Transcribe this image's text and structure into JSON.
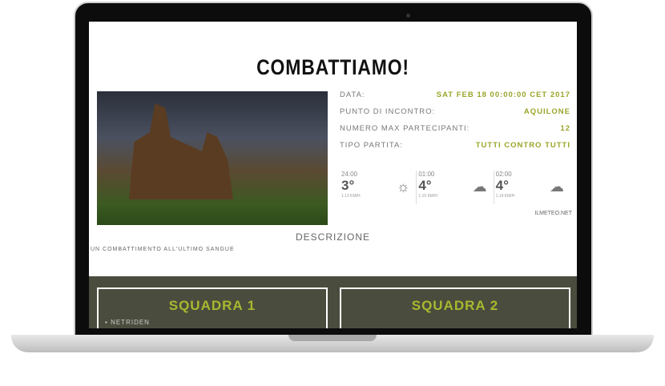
{
  "title": "COMBATTIAMO!",
  "info": [
    {
      "label": "DATA:",
      "value": "SAT FEB 18 00:00:00 CET 2017"
    },
    {
      "label": "PUNTO DI INCONTRO:",
      "value": "AQUILONE"
    },
    {
      "label": "NUMERO MAX PARTECIPANTI:",
      "value": "12"
    },
    {
      "label": "TIPO PARTITA:",
      "value": "TUTTI CONTRO TUTTI"
    }
  ],
  "weather": [
    {
      "time": "24:00",
      "temp": "3°",
      "wind": "1.13 KM/H",
      "icon": "☼"
    },
    {
      "time": "01:00",
      "temp": "4°",
      "wind": "1.10 KM/H",
      "icon": "☁"
    },
    {
      "time": "02:00",
      "temp": "4°",
      "wind": "1.14 KM/H",
      "icon": "☁"
    }
  ],
  "weather_source": "ILMETEO.NET",
  "description_heading": "DESCRIZIONE",
  "description": "UN COMBATTIMENTO ALL'ULTIMO SANGUE",
  "teams": [
    {
      "name": "SQUADRA 1",
      "members": [
        "NETRIDEN"
      ]
    },
    {
      "name": "SQUADRA 2",
      "members": []
    }
  ]
}
